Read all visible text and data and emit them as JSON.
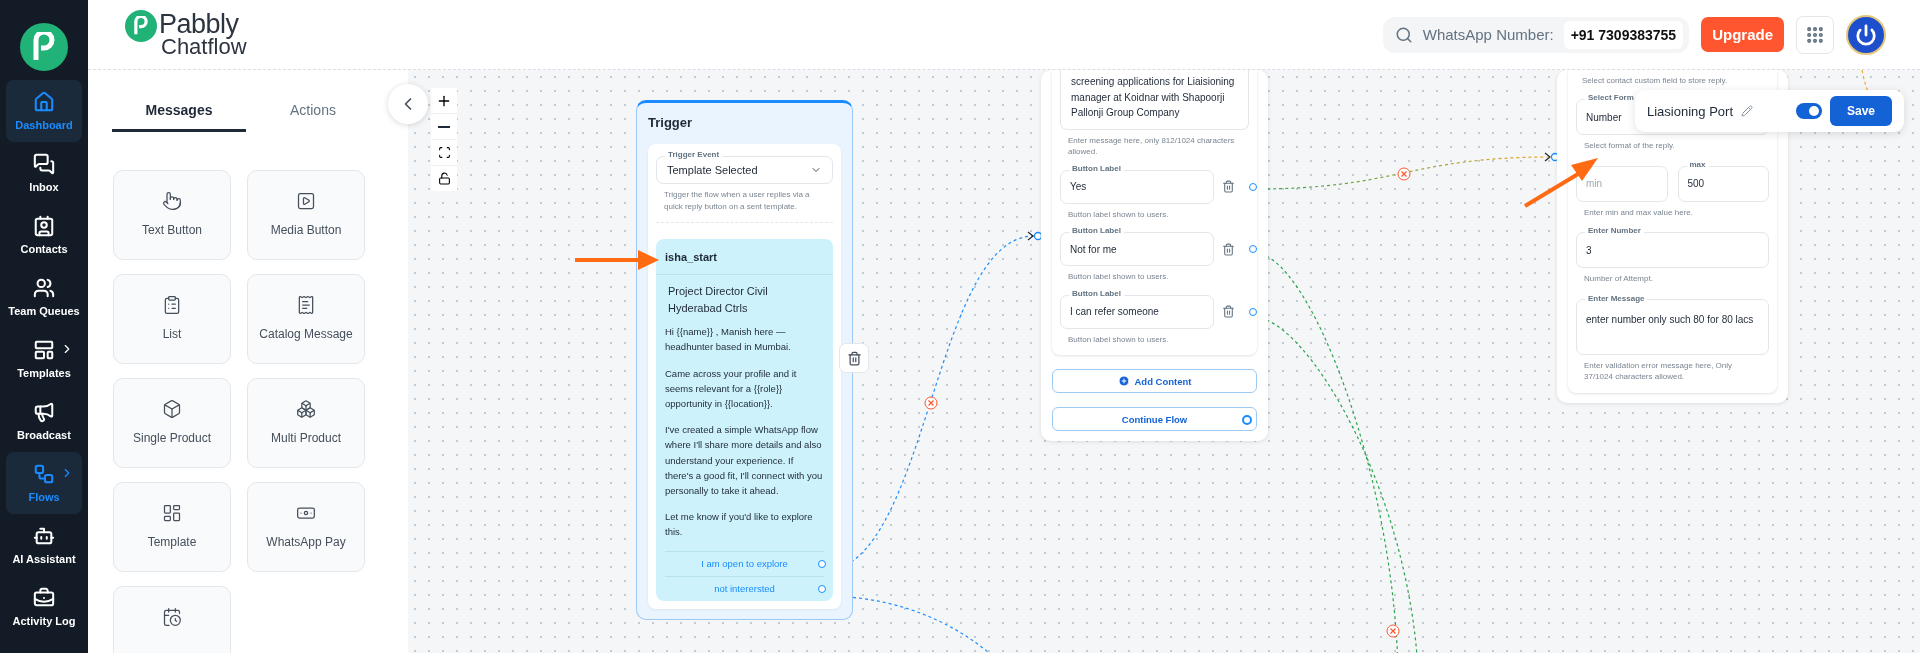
{
  "sidebar": {
    "items": [
      {
        "kind": "home",
        "label": "Dashboard",
        "selected": true,
        "submenu": false
      },
      {
        "kind": "chat",
        "label": "Inbox",
        "selected": false,
        "submenu": false
      },
      {
        "kind": "contact",
        "label": "Contacts",
        "selected": false,
        "submenu": false
      },
      {
        "kind": "team",
        "label": "Team Queues",
        "selected": false,
        "submenu": false
      },
      {
        "kind": "template",
        "label": "Templates",
        "selected": false,
        "submenu": true
      },
      {
        "kind": "megaphone",
        "label": "Broadcast",
        "selected": false,
        "submenu": false
      },
      {
        "kind": "flow",
        "label": "Flows",
        "selected": true,
        "submenu": true
      },
      {
        "kind": "bot",
        "label": "AI Assistant",
        "selected": false,
        "submenu": false
      },
      {
        "kind": "briefcase",
        "label": "Activity Log",
        "selected": false,
        "submenu": false
      }
    ]
  },
  "header": {
    "brand": [
      "Pabbly",
      "Chatflow"
    ],
    "whatsapp_label": "WhatsApp Number:",
    "whatsapp_number": "+91 7309383755",
    "upgrade": "Upgrade"
  },
  "panel": {
    "tabs": [
      {
        "label": "Messages",
        "selected": true
      },
      {
        "label": "Actions",
        "selected": false
      }
    ],
    "cards": [
      {
        "kind": "pointer",
        "label": "Text Button"
      },
      {
        "kind": "media",
        "label": "Media Button"
      },
      {
        "kind": "list",
        "label": "List"
      },
      {
        "kind": "catalog",
        "label": "Catalog Message"
      },
      {
        "kind": "box",
        "label": "Single Product"
      },
      {
        "kind": "boxes",
        "label": "Multi Product"
      },
      {
        "kind": "layout",
        "label": "Template"
      },
      {
        "kind": "money",
        "label": "WhatsApp Pay"
      },
      {
        "kind": "calendar"
      }
    ]
  },
  "trigger_node": {
    "title": "Trigger",
    "event_label": "Trigger Event",
    "event_value": "Template Selected",
    "event_hint": "Trigger the flow when a user replies via a quick reply button on a sent template.",
    "template": {
      "name": "isha_start",
      "header": "Project Director Civil Hyderabad Ctrls",
      "body": [
        "Hi {{name}} , Manish here — headhunter based in Mumbai.",
        "Came across your profile and it seems relevant for a {{role}} opportunity in {{location}}.",
        "I've created a simple WhatsApp flow where I'll share more details and also understand your experience. If there's a good fit, I'll connect with you personally to take it ahead.",
        "Let me know if you'd like to explore this."
      ],
      "buttons": [
        "I am open to explore",
        "not interersted"
      ]
    }
  },
  "message_node": {
    "message": "screening applications for Liaisioning manager at Koidnar with Shapoorji Pallonji Group Company",
    "message_hint": "Enter message here, only 812/1024 characters allowed.",
    "buttons": [
      {
        "caption": "Button Label",
        "value": "Yes",
        "hint": "Button label shown to users."
      },
      {
        "caption": "Button Label",
        "value": "Not for me",
        "hint": "Button label shown to users."
      },
      {
        "caption": "Button Label",
        "value": "I can refer someone",
        "hint": "Button label shown to users."
      }
    ],
    "add_content": "Add Content",
    "continue_flow": "Continue Flow"
  },
  "input_node": {
    "field_hint": "Select contact custom field to store reply.",
    "format_label": "Select Form",
    "format_value": "Number",
    "format_hint": "Select format of the reply.",
    "min_placeholder": "min",
    "max_label": "max",
    "max_value": "500",
    "range_hint": "Enter min and max value here.",
    "number_label": "Enter Number",
    "number_value": "3",
    "number_hint": "Number of Attempt.",
    "message_label": "Enter Message",
    "message_value": "enter number only such 80 for 80 lacs",
    "message_hint": "Enter validation error message here, Only 37/1024 characters allowed."
  },
  "name_popup": {
    "title": "Liasioning Port",
    "enabled": true,
    "save": "Save"
  }
}
